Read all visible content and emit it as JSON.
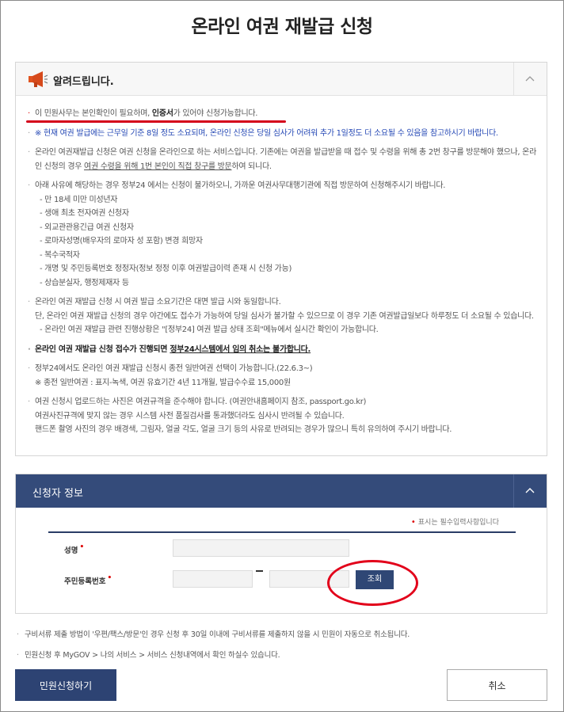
{
  "page": {
    "title": "온라인 여권 재발급 신청"
  },
  "notice": {
    "title": "알려드립니다.",
    "items": [
      {
        "type": "mixed",
        "parts": [
          "이 민원사무는 본인확인이 필요하며, ",
          "인증서",
          "가 있어야 신청가능합니다."
        ]
      },
      {
        "type": "blue",
        "text": "※ 현재 여권 발급에는 근무일 기준 8일 정도 소요되며, 온라인 신청은 당일 심사가 어려워 추가 1일정도 더 소요될 수 있음을 참고하시기 바랍니다."
      },
      {
        "type": "underline",
        "parts": [
          "온라인 여권재발급 신청은 여권 신청을 온라인으로 하는 서비스입니다. 기존에는 여권을 발급받을 때 접수 및 수령을 위해 총 2번 창구를 방문해야 했으나, 온라인 신청의 경우 ",
          "여권 수령을 위해 1번 본인이 직접 창구를 방문",
          "하여 되니다."
        ]
      },
      {
        "type": "list",
        "text": "아래 사유에 해당하는 경우 정부24 에서는 신청이 불가하오니, 가까운 여권사무대행기관에 직접 방문하여 신청해주시기 바랍니다.",
        "sub": [
          "- 만 18세 미만 미성년자",
          "- 생애 최초 전자여권 신청자",
          "- 외교관관용긴급 여권 신청자",
          "- 로마자성명(배우자의 로마자 성 포함) 변경 희망자",
          "- 복수국적자",
          "- 개명 및 주민등록번호 정정자(정보 정정 이후 여권발급이력 존재 시 신청 가능)",
          "- 상습분실자, 행정제재자 등"
        ]
      },
      {
        "type": "list",
        "text": "온라인 여권 재발급 신청 시 여권 발급 소요기간은 대면 발급 시와 동일합니다.\n단, 온라인 여권 재발급 신청의 경우 야간에도 접수가 가능하여 당일 심사가 불가할 수 있으므로 이 경우 기존 여권발급일보다 하루정도 더 소요될 수 있습니다.",
        "sub": [
          "- 온라인 여권 재발급 관련 진행상황은 \"[정부24] 여권 발급 상태 조회\"메뉴에서 실시간 확인이 가능합니다."
        ]
      },
      {
        "type": "bold",
        "parts": [
          "온라인 여권 재발급 신청 접수가 진행되면 ",
          "정부24시스템에서 임의 취소는 불가합니다."
        ]
      },
      {
        "type": "plain",
        "text": "정부24에서도 온라인 여권 재발급 신청시 종전 일반여권 선택이 가능합니다.(22.6.3~)\n※ 종전 일반여권 : 표지-녹색, 여권 유효기간 4년 11개월, 발급수수료 15,000원"
      },
      {
        "type": "plain",
        "text": "여권 신청시 업로드하는 사진은 여권규격을 준수해야 합니다. (여권안내홈페이지 참조, passport.go.kr)\n여권사진규격에 맞지 않는 경우 시스템 사전 품질검사를 통과했더라도 심사시 반려될 수 있습니다.\n핸드폰 촬영 사진의 경우 배경색, 그림자, 얼굴 각도, 얼굴 크기 등의 사유로 반려되는 경우가 많으니 특히 유의하여 주시기 바랍니다."
      }
    ]
  },
  "applicant": {
    "title": "신청자 정보",
    "required_note": "표시는 필수입력사항입니다",
    "name_label": "성명",
    "rrn_label": "주민등록번호",
    "lookup_button": "조회"
  },
  "footnotes": [
    "구비서류 제출 방법이 '우편/팩스/방문'인 경우 신청 후 30일 이내에 구비서류를 제출하지 않을 시 민원이 자동으로 취소됩니다.",
    "민원신청 후 MyGOV > 나의 서비스 > 서비스 신청내역에서 확인 하실수 있습니다."
  ],
  "actions": {
    "submit": "민원신청하기",
    "cancel": "취소"
  },
  "colors": {
    "navy": "#344b7a",
    "annotation_red": "#e2001a",
    "notice_blue": "#2548b5"
  }
}
